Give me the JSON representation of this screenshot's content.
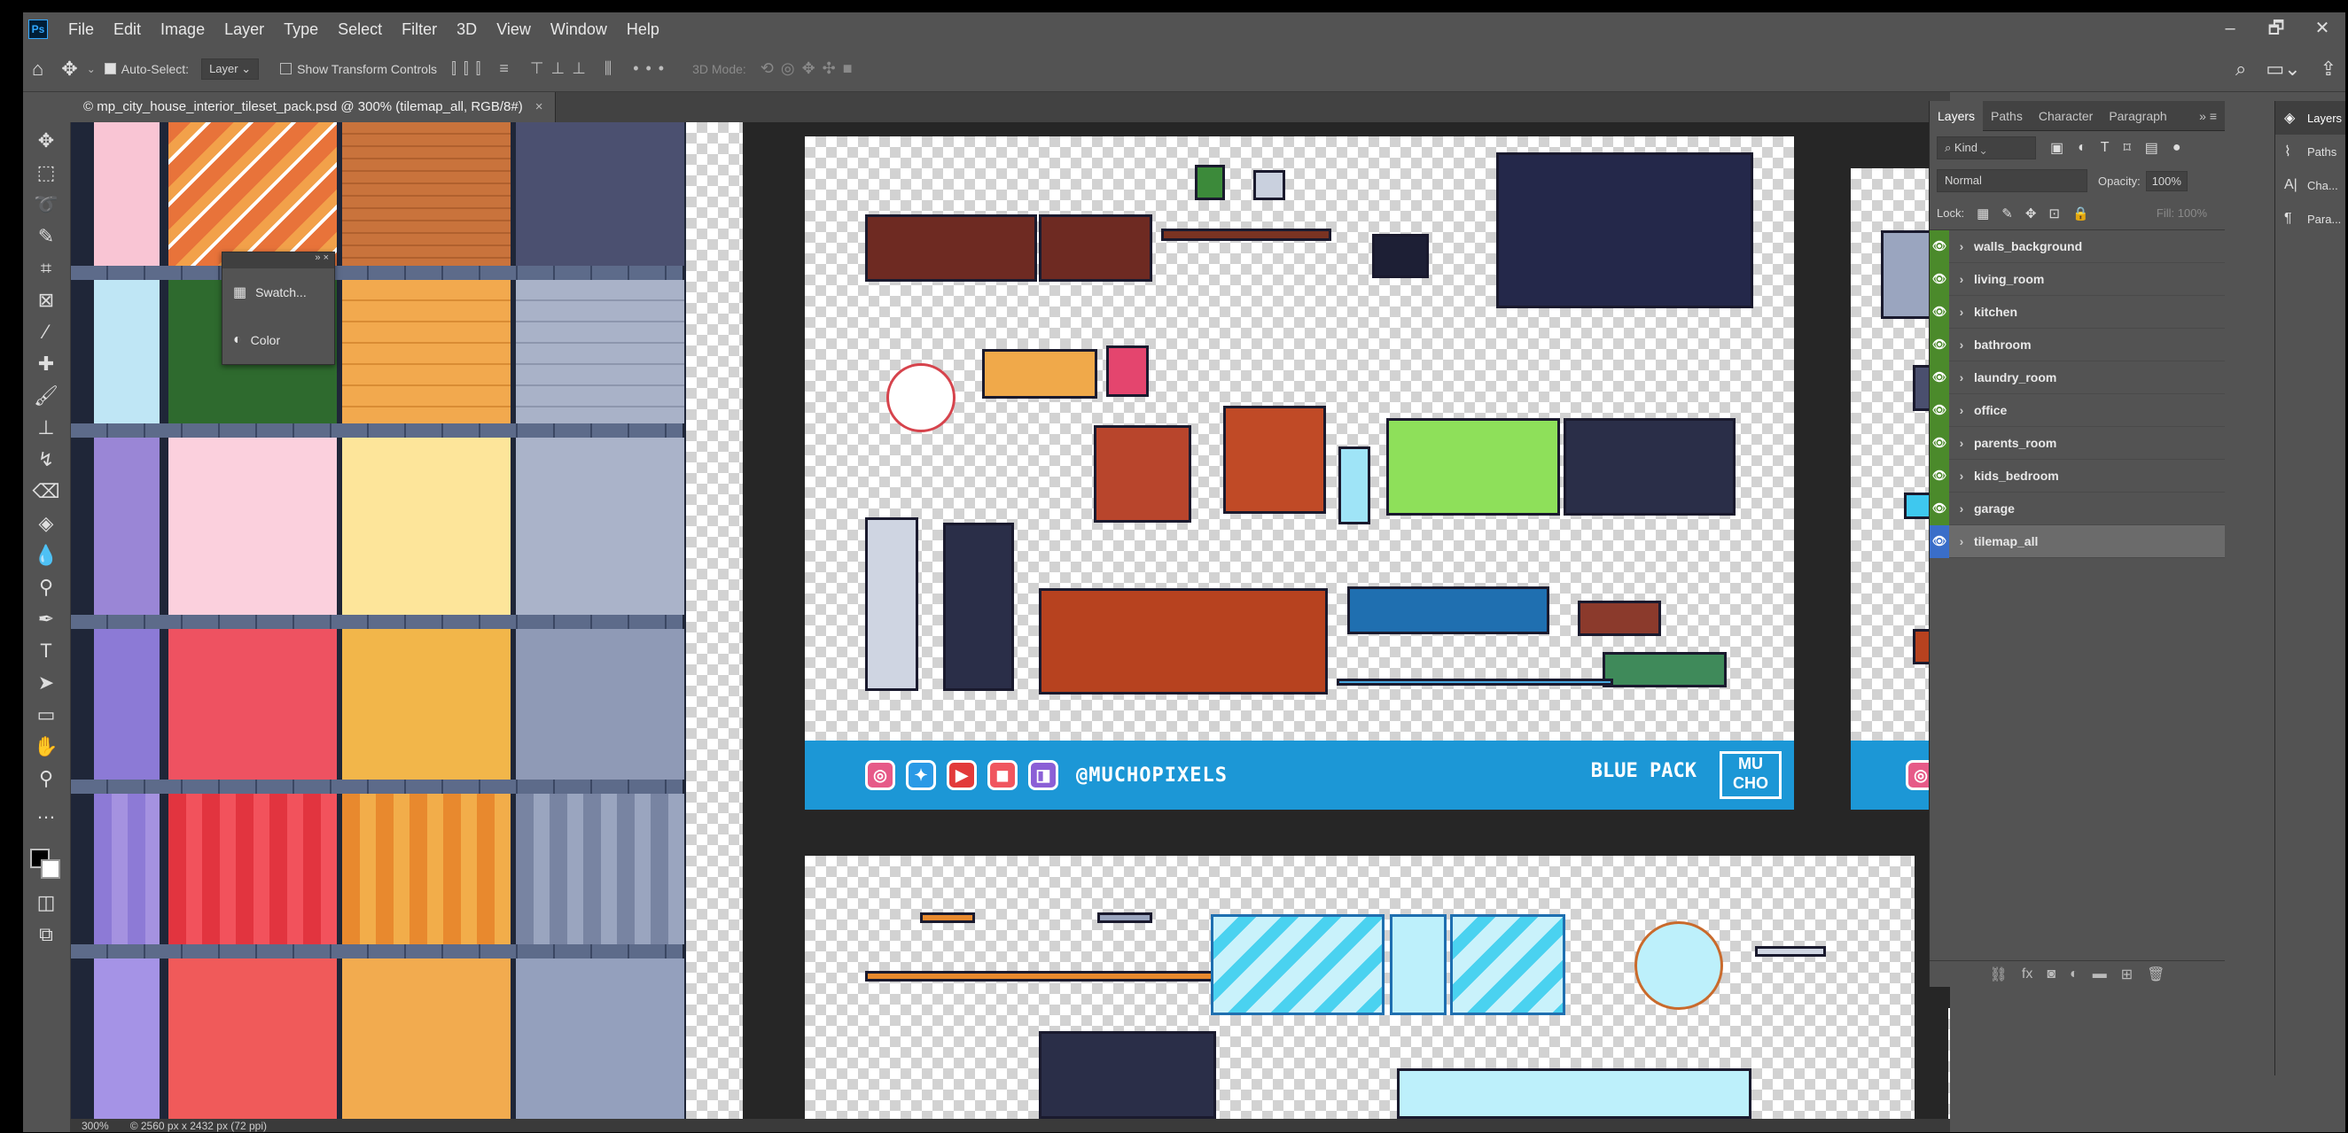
{
  "app": {
    "logo": "Ps"
  },
  "menu": [
    "File",
    "Edit",
    "Image",
    "Layer",
    "Type",
    "Select",
    "Filter",
    "3D",
    "View",
    "Window",
    "Help"
  ],
  "window_controls": [
    "–",
    "🗗",
    "✕"
  ],
  "options": {
    "auto_select_label": "Auto-Select:",
    "auto_select_value": "Layer",
    "transform_label": "Show Transform Controls",
    "mode_3d_label": "3D Mode:",
    "more": "•••"
  },
  "document": {
    "tab_title": "© mp_city_house_interior_tileset_pack.psd @ 300% (tilemap_all, RGB/8#)",
    "close": "×"
  },
  "floating_panel": {
    "items": [
      {
        "label": "Swatch...",
        "icon": "swatches-icon"
      },
      {
        "label": "Color",
        "icon": "color-wheel-icon"
      }
    ]
  },
  "banner": {
    "handle": "@MUCHOPIXELS",
    "pack": "BLUE PACK",
    "logo_text": "MU CHO"
  },
  "status": {
    "zoom": "300%",
    "doc_info": "© 2560 px x 2432 px (72 ppi)"
  },
  "layers_panel": {
    "tabs": [
      "Layers",
      "Paths",
      "Character",
      "Paragraph"
    ],
    "active_tab": "Layers",
    "filter_kind": "Kind",
    "blend_mode": "Normal",
    "opacity_label": "Opacity:",
    "opacity_value": "100%",
    "lock_label": "Lock:",
    "fill_label": "Fill:",
    "fill_value": "100%",
    "layers": [
      "walls_background",
      "living_room",
      "kitchen",
      "bathroom",
      "laundry_room",
      "office",
      "parents_room",
      "kids_bedroom",
      "garage",
      "tilemap_all"
    ],
    "selected_layer": "tilemap_all"
  },
  "dock": {
    "items": [
      {
        "label": "Layers",
        "icon": "layers-icon"
      },
      {
        "label": "Paths",
        "icon": "paths-icon"
      },
      {
        "label": "Cha...",
        "icon": "character-icon"
      },
      {
        "label": "Para...",
        "icon": "paragraph-icon"
      }
    ]
  },
  "colors": {
    "accent": "#31a8ff",
    "banner": "#1c97d6",
    "eye_green": "#4b8a2b",
    "selected_blue": "#3a6ec9"
  }
}
